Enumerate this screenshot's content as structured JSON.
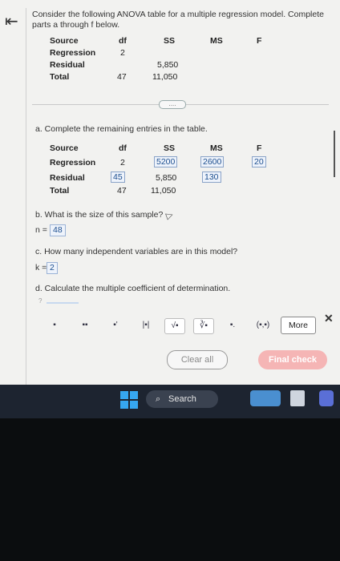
{
  "intro_text": "Consider the following ANOVA table for a multiple regression model. Complete parts a through f below.",
  "table1": {
    "headers": [
      "Source",
      "df",
      "SS",
      "MS",
      "F"
    ],
    "rows": [
      {
        "source": "Regression",
        "df": "2",
        "ss": "",
        "ms": "",
        "f": ""
      },
      {
        "source": "Residual",
        "df": "",
        "ss": "5,850",
        "ms": "",
        "f": ""
      },
      {
        "source": "Total",
        "df": "47",
        "ss": "11,050",
        "ms": "",
        "f": ""
      }
    ]
  },
  "divider_dots": "....",
  "part_a": {
    "question": "a. Complete the remaining entries in the table.",
    "headers": [
      "Source",
      "df",
      "SS",
      "MS",
      "F"
    ],
    "rows": [
      {
        "source": "Regression",
        "df": "2",
        "ss": "5200",
        "ms": "2600",
        "f": "20"
      },
      {
        "source": "Residual",
        "df": "45",
        "ss": "5,850",
        "ms": "130",
        "f": ""
      },
      {
        "source": "Total",
        "df": "47",
        "ss": "11,050",
        "ms": "",
        "f": ""
      }
    ]
  },
  "part_b": {
    "question": "b. What is the size of this sample?",
    "label": "n =",
    "value": "48"
  },
  "part_c": {
    "question": "c. How many independent variables are in this model?",
    "label": "k =",
    "value": "2"
  },
  "part_d": {
    "question": "d. Calculate the multiple coefficient of determination.",
    "caret": "?"
  },
  "toolbar": {
    "tools": [
      "▪",
      "▪▪",
      "▪'",
      "|▪|",
      "√▪",
      "∛▪",
      "▪.",
      "(▪,▪)"
    ],
    "more_label": "More",
    "close": "✕"
  },
  "buttons": {
    "clear_all": "Clear all",
    "final_check": "Final check"
  },
  "taskbar": {
    "search_label": "Search"
  }
}
